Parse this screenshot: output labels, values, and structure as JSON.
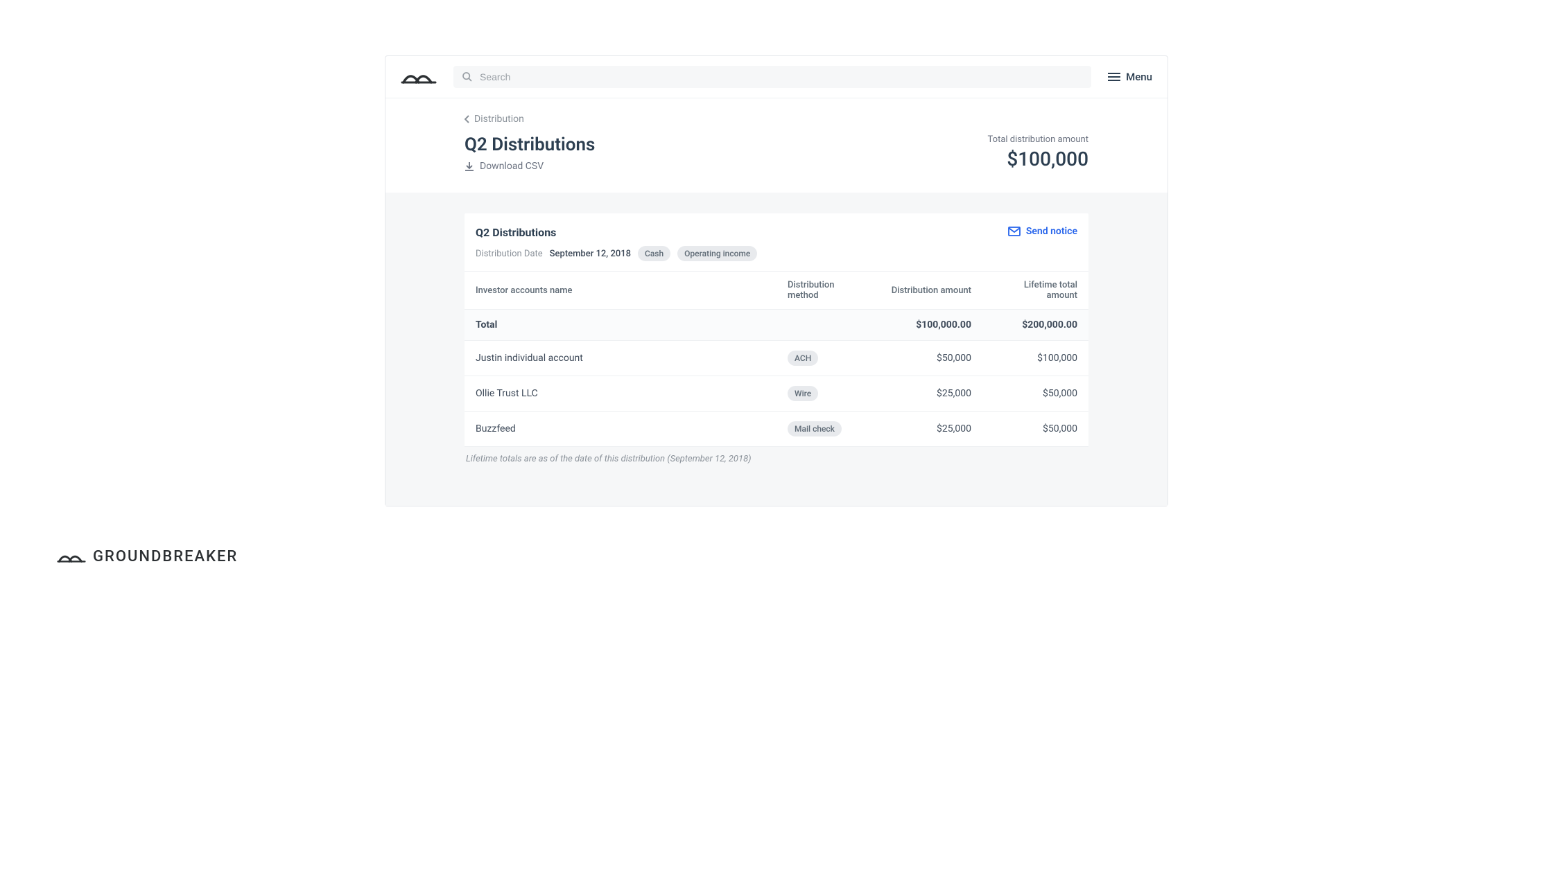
{
  "header": {
    "search_placeholder": "Search",
    "menu_label": "Menu"
  },
  "breadcrumb": {
    "label": "Distribution"
  },
  "page": {
    "title": "Q2 Distributions",
    "download_label": "Download CSV",
    "total_label": "Total  distribution amount",
    "total_amount": "$100,000"
  },
  "card": {
    "title": "Q2 Distributions",
    "date_label": "Distribution Date",
    "date_value": "September 12, 2018",
    "tag1": "Cash",
    "tag2": "Operating income",
    "send_notice_label": "Send notice"
  },
  "table": {
    "headers": {
      "name": "Investor accounts name",
      "method": "Distribution method",
      "amount": "Distribution amount",
      "lifetime": "Lifetime total amount"
    },
    "total_row": {
      "label": "Total",
      "amount": "$100,000.00",
      "lifetime": "$200,000.00"
    },
    "rows": [
      {
        "name": "Justin individual account",
        "method": "ACH",
        "amount": "$50,000",
        "lifetime": "$100,000"
      },
      {
        "name": "Ollie Trust LLC",
        "method": "Wire",
        "amount": "$25,000",
        "lifetime": "$50,000"
      },
      {
        "name": "Buzzfeed",
        "method": "Mail check",
        "amount": "$25,000",
        "lifetime": "$50,000"
      }
    ],
    "footnote": "Lifetime totals are as of the date of this distribution (September 12, 2018)"
  },
  "brand": {
    "name": "GROUNDBREAKER"
  }
}
